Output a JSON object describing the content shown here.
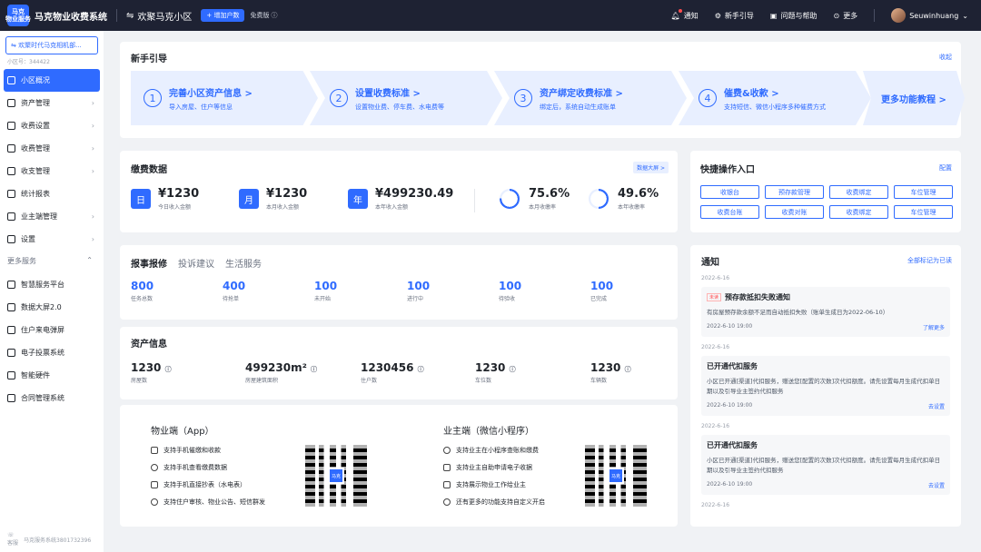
{
  "topbar": {
    "logo_text": "马克\n物业服务",
    "app_name": "马克物业收费系统",
    "community": "欢聚马克小区",
    "add_households": "+ 增加户数",
    "free_version": "免费版",
    "items": [
      {
        "label": "通知",
        "icon": "bell-icon"
      },
      {
        "label": "新手引导",
        "icon": "compass-icon"
      },
      {
        "label": "问题与帮助",
        "icon": "help-icon"
      },
      {
        "label": "更多",
        "icon": "more-icon"
      }
    ],
    "username": "Seuwinhuang"
  },
  "sidebar": {
    "org_name": "欢聚时代马克相机部...",
    "org_id": "小区号：344422",
    "items": [
      {
        "label": "小区概况",
        "active": true
      },
      {
        "label": "资产管理"
      },
      {
        "label": "收费设置"
      },
      {
        "label": "收费管理"
      },
      {
        "label": "收支管理"
      },
      {
        "label": "统计报表"
      },
      {
        "label": "业主端管理"
      },
      {
        "label": "设置"
      }
    ],
    "more_title": "更多服务",
    "more_items": [
      {
        "label": "智慧服务平台"
      },
      {
        "label": "数据大屏2.0"
      },
      {
        "label": "住户来电弹屏"
      },
      {
        "label": "电子投票系统"
      },
      {
        "label": "智能硬件"
      },
      {
        "label": "合同管理系统"
      }
    ],
    "footer_label": "客服",
    "footer_phone": "马克服务系统3801732396"
  },
  "guide": {
    "title": "新手引导",
    "collapse": "收起",
    "steps": [
      {
        "num": "1",
        "title": "完善小区资产信息 >",
        "desc": "导入房屋、住户等信息"
      },
      {
        "num": "2",
        "title": "设置收费标准 >",
        "desc": "设置物业费、停车费、水电费等"
      },
      {
        "num": "3",
        "title": "资产绑定收费标准 >",
        "desc": "绑定后，系统自动生成账单"
      },
      {
        "num": "4",
        "title": "催费&收款 >",
        "desc": "支持短信、微信小程序多种催费方式"
      }
    ],
    "more": "更多功能教程 >"
  },
  "payment": {
    "title": "缴费数据",
    "screen_link": "数据大屏 >",
    "stats": [
      {
        "badge": "日",
        "value": "¥1230",
        "label": "今日收入金额"
      },
      {
        "badge": "月",
        "value": "¥1230",
        "label": "本月收入金额"
      },
      {
        "badge": "年",
        "value": "¥499230.49",
        "label": "本年收入金额"
      }
    ],
    "rates": [
      {
        "value": "75.6%",
        "label": "本月收缴率",
        "fraction": 0.756
      },
      {
        "value": "49.6%",
        "label": "本年收缴率",
        "fraction": 0.496
      }
    ]
  },
  "quick": {
    "title": "快捷操作入口",
    "config": "配置",
    "buttons": [
      "收银台",
      "预存款管理",
      "收费绑定",
      "车位管理",
      "收费台账",
      "收费对账",
      "收费绑定",
      "车位管理"
    ]
  },
  "repair": {
    "tabs": [
      "报事报修",
      "投诉建议",
      "生活服务"
    ],
    "counts": [
      {
        "n": "800",
        "label": "任务总数"
      },
      {
        "n": "400",
        "label": "待抢单"
      },
      {
        "n": "100",
        "label": "未开始"
      },
      {
        "n": "100",
        "label": "进行中"
      },
      {
        "n": "100",
        "label": "待验收"
      },
      {
        "n": "100",
        "label": "已完成"
      }
    ]
  },
  "asset": {
    "title": "资产信息",
    "cells": [
      {
        "n": "1230",
        "label": "房屋数"
      },
      {
        "n": "499230m²",
        "label": "房屋建筑面积"
      },
      {
        "n": "1230456",
        "label": "住户数"
      },
      {
        "n": "1230",
        "label": "车位数"
      },
      {
        "n": "1230",
        "label": "车辆数"
      }
    ]
  },
  "apps": {
    "property": {
      "title": "物业端（App）",
      "features": [
        "支持手机催缴和收款",
        "支持手机查看缴费数据",
        "支持手机直接抄表（水电表）",
        "支持住户审核、物业公告、短信群发"
      ]
    },
    "owner": {
      "title": "业主端（微信小程序）",
      "features": [
        "支持业主在小程序查账和缴费",
        "支持业主自助申请电子收据",
        "支持展示物业工作给业主",
        "还有更多的功能支持自定义开启"
      ]
    },
    "qr_mark": "马克"
  },
  "notice": {
    "title": "通知",
    "mark_all": "全部标记为已读",
    "items": [
      {
        "date": "2022-6-16",
        "tag": "未读",
        "title": "预存款抵扣失败通知",
        "body": "有房屋预存款余额不足而自动抵扣失败（账单生成日为2022-06-10）",
        "time": "2022-6-10 19:00",
        "action": "了解更多"
      },
      {
        "date": "2022-6-16",
        "tag": "",
        "title": "已开通代扣服务",
        "body": "小区已开通[渠道]代扣服务，赠送您[配置的次数]次代扣额度。请先设置每月生成代扣单日期以及引导业主签约代扣服务",
        "time": "2022-6-10 19:00",
        "action": "去设置"
      },
      {
        "date": "2022-6-16",
        "tag": "",
        "title": "已开通代扣服务",
        "body": "小区已开通[渠道]代扣服务，赠送您[配置的次数]次代扣额度。请先设置每月生成代扣单日期以及引导业主签约代扣服务",
        "time": "2022-6-10 19:00",
        "action": "去设置"
      }
    ],
    "trailing_date": "2022-6-16"
  },
  "colors": {
    "accent": "#2f6bff",
    "topbar": "#1e2233",
    "background": "#f0f2f5"
  }
}
